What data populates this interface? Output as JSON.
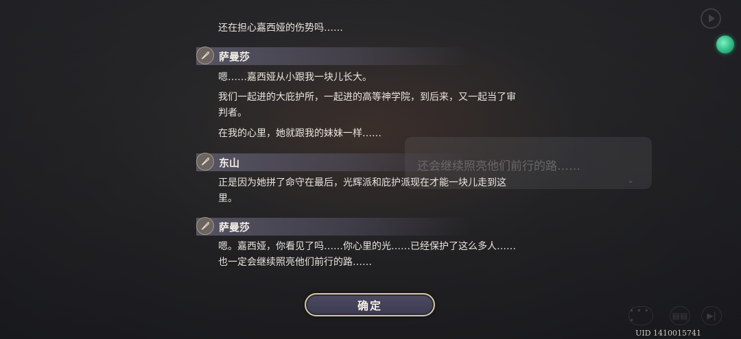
{
  "background": {
    "dialog_text": "还会继续照亮他们前行的路……",
    "dialog_arrow": "⌄"
  },
  "log": {
    "intro_line": "还在担心嘉西娅的伤势吗……",
    "entries": [
      {
        "speaker": "萨曼莎",
        "lines": [
          "嗯……嘉西娅从小跟我一块儿长大。",
          "我们一起进的大庇护所，一起进的高等神学院，到后来，又一起当了审判者。",
          "在我的心里，她就跟我的妹妹一样……"
        ]
      },
      {
        "speaker": "东山",
        "lines": [
          "正是因为她拼了命守在最后，光辉派和庇护派现在才能一块儿走到这里。"
        ]
      },
      {
        "speaker": "萨曼莎",
        "lines": [
          "嗯。嘉西娅，你看见了吗……你心里的光……已经保护了这么多人……也一定会继续照亮他们前行的路……"
        ]
      }
    ]
  },
  "confirm_label": "确定",
  "uid": "UID 1410015741",
  "controls": {
    "auto_label": "• • • •",
    "log_label": "▤▤",
    "skip_label": "▶|"
  },
  "colors": {
    "gem": "#2fb985",
    "button_border": "#d9c9a0"
  },
  "icons": {
    "speaker_icon": "quill-icon"
  }
}
